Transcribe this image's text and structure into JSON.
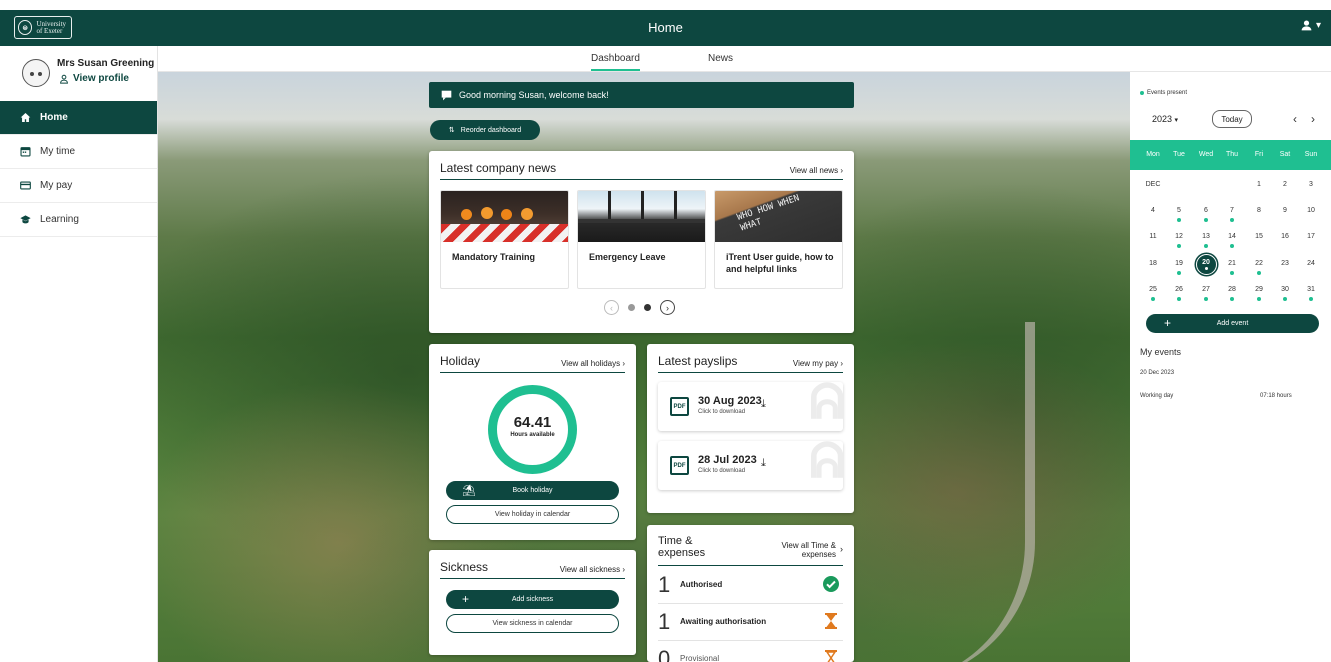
{
  "header": {
    "logo_text": "University of Exeter",
    "title": "Home"
  },
  "tabs": [
    {
      "label": "Dashboard",
      "active": true
    },
    {
      "label": "News",
      "active": false
    }
  ],
  "profile": {
    "name": "Mrs Susan Greening",
    "view_profile": "View profile"
  },
  "sidebar": {
    "items": [
      {
        "label": "Home",
        "icon": "home-icon",
        "active": true
      },
      {
        "label": "My time",
        "icon": "calendar-icon",
        "active": false
      },
      {
        "label": "My pay",
        "icon": "card-icon",
        "active": false
      },
      {
        "label": "Learning",
        "icon": "graduation-cap-icon",
        "active": false
      }
    ]
  },
  "welcome": "Good morning Susan, welcome back!",
  "reorder_label": "Reorder dashboard",
  "news": {
    "title": "Latest company news",
    "view_all": "View all news",
    "items": [
      {
        "label": "Mandatory Training"
      },
      {
        "label": "Emergency Leave"
      },
      {
        "label": "iTrent User guide, how to and helpful links",
        "image_text": "WHO HOW WHEN WHAT"
      }
    ],
    "carousel": {
      "pages": 2,
      "current": 2
    }
  },
  "holiday": {
    "title": "Holiday",
    "view_all": "View all holidays",
    "hours": "64.41",
    "hours_label": "Hours available",
    "book": "Book holiday",
    "view_calendar": "View holiday in calendar"
  },
  "payslips": {
    "title": "Latest payslips",
    "view_all": "View my pay",
    "items": [
      {
        "date": "30 Aug 2023",
        "sub": "Click to download"
      },
      {
        "date": "28 Jul 2023",
        "sub": "Click to download"
      }
    ]
  },
  "sickness": {
    "title": "Sickness",
    "view_all": "View all sickness",
    "add": "Add sickness",
    "view_calendar": "View sickness in calendar"
  },
  "time_expenses": {
    "title_line1": "Time &",
    "title_line2": "expenses",
    "view_all_line1": "View all Time &",
    "view_all_line2": "expenses",
    "rows": [
      {
        "count": "1",
        "label": "Authorised",
        "icon": "check-circle-icon"
      },
      {
        "count": "1",
        "label": "Awaiting authorisation",
        "icon": "hourglass-icon"
      },
      {
        "count": "0",
        "label": "Provisional",
        "icon": "hourglass-outline-icon"
      }
    ]
  },
  "calendar": {
    "events_present": "Events present",
    "year": "2023",
    "today": "Today",
    "month_label": "DEC",
    "weekdays": [
      "Mon",
      "Tue",
      "Wed",
      "Thu",
      "Fri",
      "Sat",
      "Sun"
    ],
    "weeks": [
      [
        "",
        "",
        "",
        "",
        "1",
        "2",
        "3"
      ],
      [
        "4",
        "5",
        "6",
        "7",
        "8",
        "9",
        "10"
      ],
      [
        "11",
        "12",
        "13",
        "14",
        "15",
        "16",
        "17"
      ],
      [
        "18",
        "19",
        "20",
        "21",
        "22",
        "23",
        "24"
      ],
      [
        "25",
        "26",
        "27",
        "28",
        "29",
        "30",
        "31"
      ]
    ],
    "event_days": [
      "5",
      "6",
      "7",
      "12",
      "13",
      "14",
      "19",
      "20",
      "21",
      "22",
      "25",
      "26",
      "27",
      "28",
      "29",
      "30",
      "31"
    ],
    "today_day": "20",
    "add_event": "Add event"
  },
  "my_events": {
    "title": "My events",
    "date": "20 Dec 2023",
    "type": "Working day",
    "hours": "07:18 hours"
  },
  "colors": {
    "primary": "#0d4740",
    "accent": "#1fbf91",
    "warning": "#e07a1f"
  }
}
